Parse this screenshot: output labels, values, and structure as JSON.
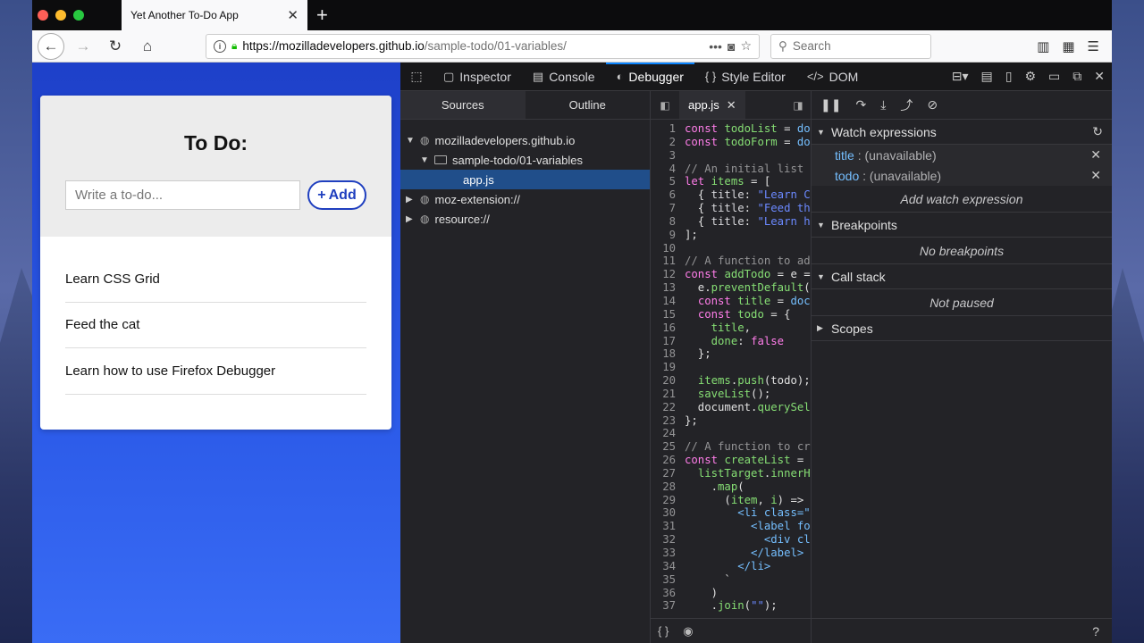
{
  "browser": {
    "tab_title": "Yet Another To-Do App",
    "url_host": "https://mozilladevelopers.github.io",
    "url_path": "/sample-todo/01-variables/",
    "search_placeholder": "Search"
  },
  "app": {
    "heading": "To Do:",
    "input_placeholder": "Write a to-do...",
    "add_label": "Add",
    "items": [
      "Learn CSS Grid",
      "Feed the cat",
      "Learn how to use Firefox Debugger"
    ]
  },
  "devtools": {
    "tabs": [
      "Inspector",
      "Console",
      "Debugger",
      "Style Editor",
      "DOM"
    ],
    "active_tab": "Debugger",
    "sources_tab": "Sources",
    "outline_tab": "Outline",
    "tree": {
      "host": "mozilladevelopers.github.io",
      "folder": "sample-todo/01-variables",
      "file": "app.js",
      "ext": "moz-extension://",
      "resource": "resource://"
    },
    "editor_file": "app.js",
    "line_numbers": [
      1,
      2,
      3,
      4,
      5,
      6,
      7,
      8,
      9,
      10,
      11,
      12,
      13,
      14,
      15,
      16,
      17,
      18,
      19,
      20,
      21,
      22,
      23,
      24,
      25,
      26,
      27,
      28,
      29,
      30,
      31,
      32,
      33,
      34,
      35,
      36,
      37
    ],
    "panel": {
      "watch_title": "Watch expressions",
      "watch_items": [
        {
          "name": "title",
          "value": ": (unavailable)"
        },
        {
          "name": "todo",
          "value": ": (unavailable)"
        }
      ],
      "add_watch": "Add watch expression",
      "breakpoints_title": "Breakpoints",
      "no_breakpoints": "No breakpoints",
      "callstack_title": "Call stack",
      "not_paused": "Not paused",
      "scopes_title": "Scopes",
      "help": "?"
    }
  }
}
